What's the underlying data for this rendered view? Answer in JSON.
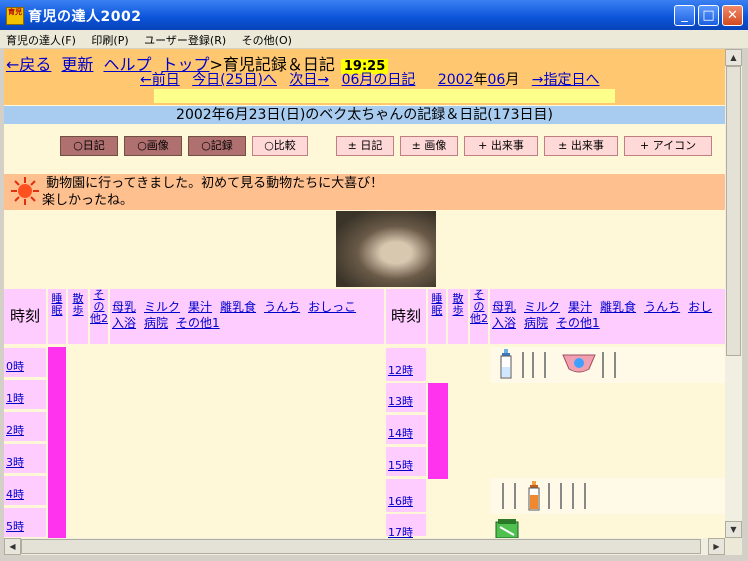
{
  "window": {
    "title": "育児の達人2002",
    "min": "_",
    "max": "□",
    "close": "✕",
    "app_icon_text": "育児"
  },
  "menu": [
    "育児の達人(F)",
    "印刷(P)",
    "ユーザー登録(R)",
    "その他(O)"
  ],
  "nav": {
    "back": "←戻る",
    "refresh": "更新",
    "help": "ヘルプ",
    "top": "トップ",
    "page": ">育児記録＆日記",
    "time": "19:25",
    "prev_day": "←前日",
    "today": "今日(25日)へ",
    "next_day": "次日→",
    "month_diary": "06月の日記",
    "year_text": "2002",
    "year_sep": "年",
    "month_text": "06",
    "month_sep": "月",
    "specified": "→指定日へ"
  },
  "header": {
    "date_title": "2002年6月23日(日)のベク太ちゃんの記録＆日記(173日目)"
  },
  "buttons": {
    "view": [
      "○日記",
      "○画像",
      "○記録",
      "○比較"
    ],
    "edit": [
      "± 日記",
      "± 画像",
      "+ 出来事",
      "± 出来事",
      "+ アイコン"
    ]
  },
  "diary": {
    "text": " 動物園に行ってきました。初めて見る動物たちに大喜び！\n楽しかったね。"
  },
  "table": {
    "time_header": "時刻",
    "sleep_header": "睡眠",
    "walk_header": "散歩",
    "other2_header": "その他2",
    "links_left": [
      "母乳",
      "ミルク",
      "果汁",
      "離乳食",
      "うんち",
      "おしっこ",
      "入浴",
      "病院",
      "その他1"
    ],
    "links_right": [
      "母乳",
      "ミルク",
      "果汁",
      "離乳食",
      "うんち",
      "おし",
      "入浴",
      "病院",
      "その他1"
    ],
    "hours_left": [
      "0時",
      "1時",
      "2時",
      "3時",
      "4時",
      "5時"
    ],
    "hours_right": [
      "12時",
      "13時",
      "14時",
      "15時",
      "16時",
      "17時"
    ]
  },
  "colors": {
    "sleep": "#ff33ee",
    "header_pink": "#ffccff",
    "nav_orange": "#ffc870",
    "date_blue": "#a8ccf0"
  }
}
